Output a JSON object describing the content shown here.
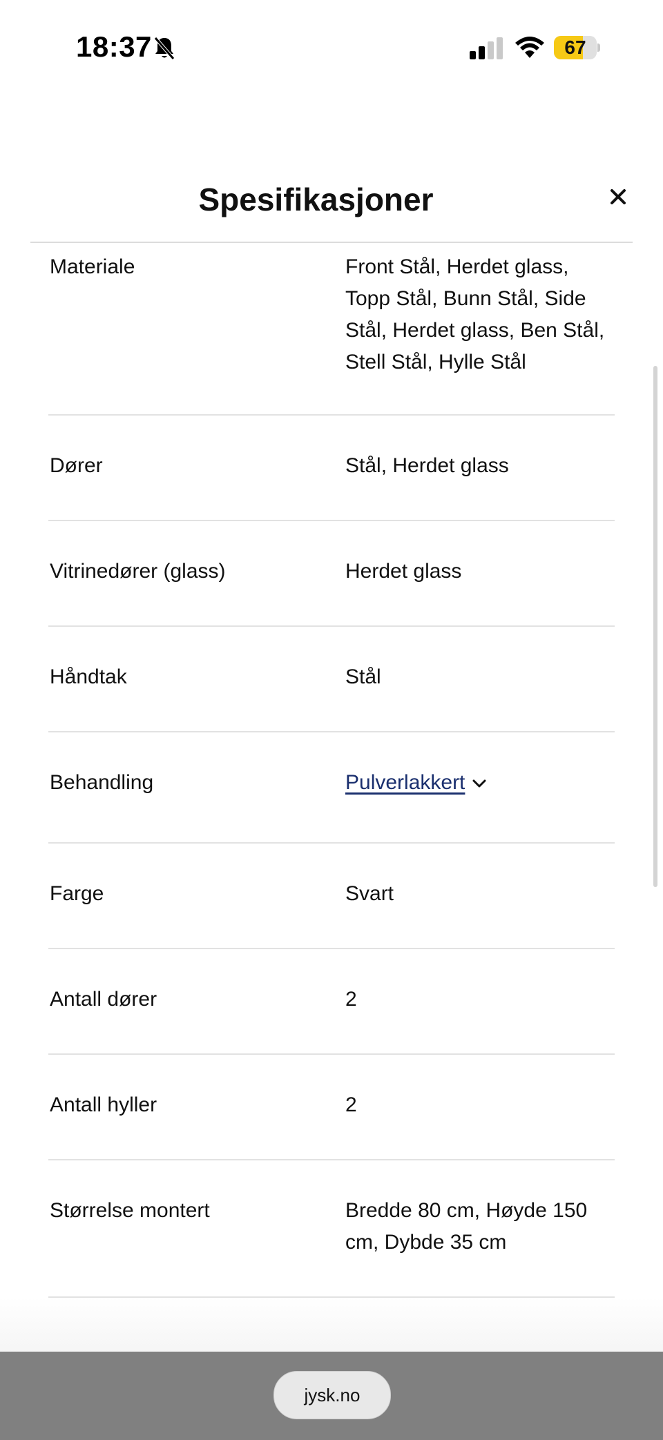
{
  "status_bar": {
    "time": "18:37",
    "battery": "67",
    "battery_level": 0.67
  },
  "modal": {
    "title": "Spesifikasjoner",
    "close_label": "×"
  },
  "specs": [
    {
      "label": "Materiale",
      "value_lines": [
        "Front Stål, Herdet glass,",
        "Topp Stål, Bunn Stål, Side",
        "Stål, Herdet glass, Ben Stål,",
        "Stell Stål, Hylle Stål"
      ]
    },
    {
      "label": "Dører",
      "value_lines": [
        "Stål, Herdet glass"
      ]
    },
    {
      "label": "Vitrinedører (glass)",
      "value_lines": [
        "Herdet glass"
      ]
    },
    {
      "label": "Håndtak",
      "value_lines": [
        "Stål"
      ]
    },
    {
      "label": "Behandling",
      "value_lines": [
        "Pulverlakkert"
      ],
      "is_link": true
    },
    {
      "label": "Farge",
      "value_lines": [
        "Svart"
      ]
    },
    {
      "label": "Antall dører",
      "value_lines": [
        "2"
      ]
    },
    {
      "label": "Antall hyller",
      "value_lines": [
        "2"
      ]
    },
    {
      "label": "Størrelse montert",
      "value_lines": [
        "Bredde 80 cm, Høyde 150",
        "cm, Dybde 35 cm"
      ]
    }
  ],
  "browser": {
    "url": "jysk.no"
  }
}
